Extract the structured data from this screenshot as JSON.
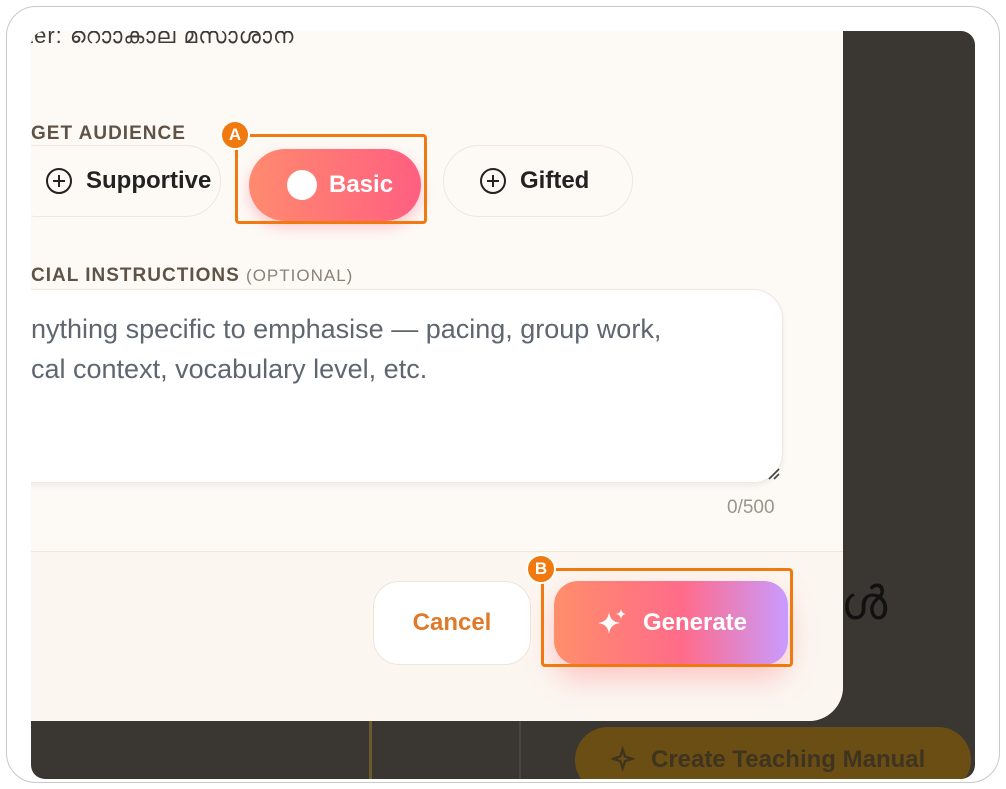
{
  "modal": {
    "top_text": "ter: റൊാകാല മസാശാന",
    "audience": {
      "label": "GET AUDIENCE",
      "options": [
        {
          "label": "Supportive",
          "selected": false,
          "icon": "plus-circle-icon"
        },
        {
          "label": "Basic",
          "selected": true,
          "icon": "dot-icon"
        },
        {
          "label": "Gifted",
          "selected": false,
          "icon": "plus-circle-icon"
        }
      ]
    },
    "instructions": {
      "label": "CIAL INSTRUCTIONS",
      "optional": "(OPTIONAL)",
      "placeholder": "nything specific to emphasise — pacing, group work,\ncal context, vocabulary level, etc.",
      "counter": "0/500"
    },
    "footer": {
      "cancel_label": "Cancel",
      "generate_label": "Generate"
    }
  },
  "background": {
    "glyph": "ൾ",
    "create_button_label": "Create Teaching Manual"
  },
  "annotations": {
    "a": "A",
    "b": "B"
  },
  "colors": {
    "accent": "#f07a10",
    "chip_gradient_start": "#ff8a6f",
    "chip_gradient_end": "#ff5f80",
    "generate_gradient_end": "#c99bff"
  }
}
